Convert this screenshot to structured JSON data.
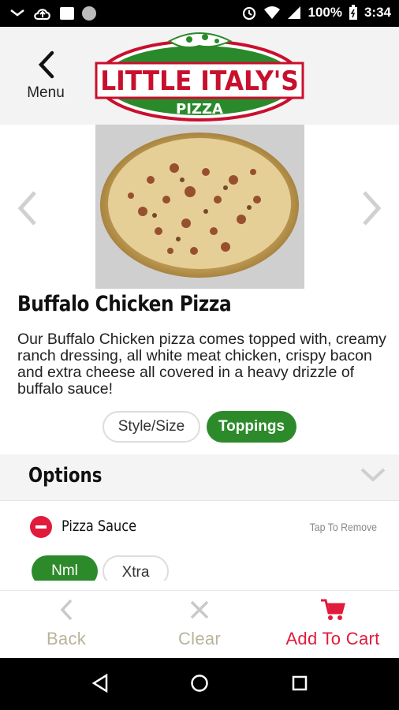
{
  "status_bar": {
    "battery": "100%",
    "time": "3:34"
  },
  "header": {
    "back_label": "Menu",
    "logo_text": "LITTLE ITALY'S",
    "logo_subtext": "PIZZA"
  },
  "item": {
    "title": "Buffalo Chicken Pizza",
    "description": "Our Buffalo Chicken pizza comes topped with, creamy ranch dressing, all white meat chicken, crispy bacon and extra cheese all covered in a heavy drizzle of buffalo sauce!"
  },
  "tabs": [
    {
      "label": "Style/Size",
      "active": false
    },
    {
      "label": "Toppings",
      "active": true
    }
  ],
  "options": {
    "title": "Options",
    "topping": {
      "name": "Pizza Sauce",
      "hint": "Tap To Remove"
    },
    "amounts": [
      {
        "label": "Nml",
        "selected": true
      },
      {
        "label": "Xtra",
        "selected": false
      }
    ]
  },
  "bottom_bar": {
    "back": "Back",
    "clear": "Clear",
    "add_to_cart": "Add To Cart"
  },
  "colors": {
    "brand_green": "#2d8a2b",
    "brand_red": "#e01b3c",
    "muted_text": "#b8b49a"
  }
}
